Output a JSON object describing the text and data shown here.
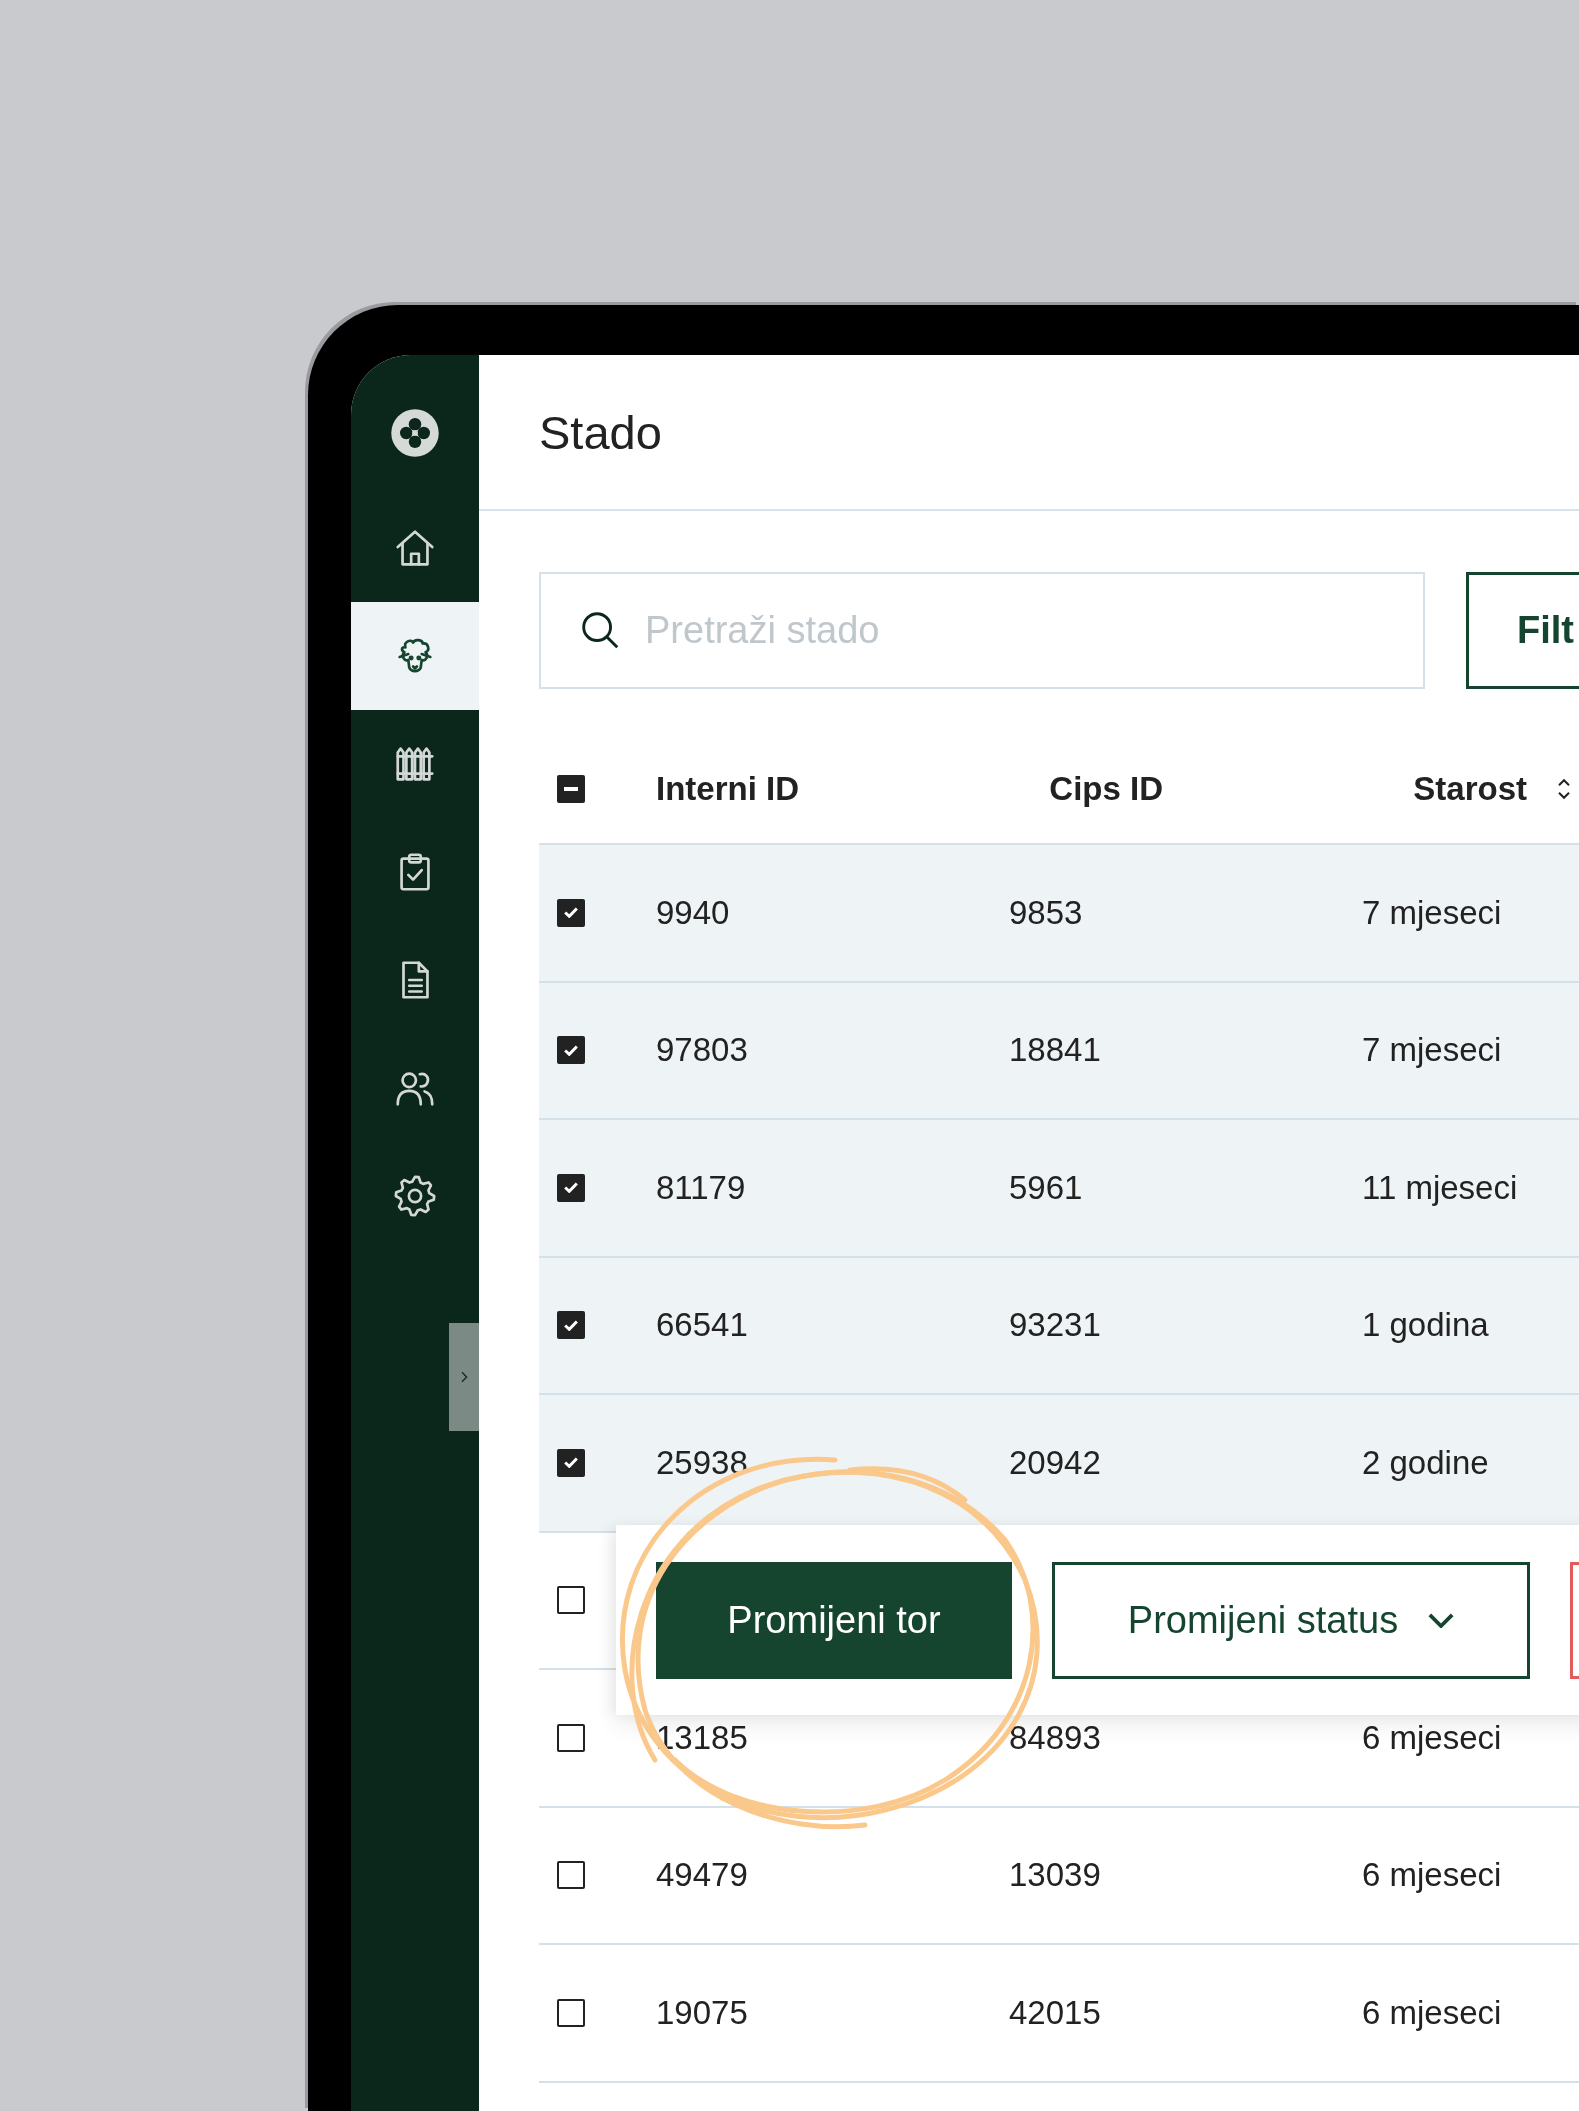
{
  "sidebar": {
    "items": [
      {
        "kind": "home",
        "selected": false
      },
      {
        "kind": "herd",
        "selected": true
      },
      {
        "kind": "fence",
        "selected": false
      },
      {
        "kind": "tasks",
        "selected": false
      },
      {
        "kind": "document",
        "selected": false
      },
      {
        "kind": "users",
        "selected": false
      },
      {
        "kind": "settings",
        "selected": false
      }
    ]
  },
  "header": {
    "title": "Stado"
  },
  "search": {
    "placeholder": "Pretraži stado"
  },
  "filter_button": {
    "label": "Filt"
  },
  "table": {
    "select_all": {
      "indeterminate": true
    },
    "columns": [
      {
        "label": "Interni ID",
        "sortable": false
      },
      {
        "label": "Cips ID",
        "sortable": false
      },
      {
        "label": "Starost",
        "sortable": true
      }
    ],
    "rows": [
      {
        "checked": true,
        "cells": [
          "9940",
          "9853",
          "7 mjeseci"
        ]
      },
      {
        "checked": true,
        "cells": [
          "97803",
          "18841",
          "7 mjeseci"
        ]
      },
      {
        "checked": true,
        "cells": [
          "81179",
          "5961",
          "11 mjeseci"
        ]
      },
      {
        "checked": true,
        "cells": [
          "66541",
          "93231",
          "1 godina"
        ]
      },
      {
        "checked": true,
        "cells": [
          "25938",
          "20942",
          "2 godine"
        ]
      },
      {
        "checked": false
      },
      {
        "checked": false,
        "cells": [
          "13185",
          "84893",
          "6 mjeseci"
        ]
      },
      {
        "checked": false,
        "cells": [
          "49479",
          "13039",
          "6 mjeseci"
        ]
      },
      {
        "checked": false,
        "cells": [
          "19075",
          "42015",
          "6 mjeseci"
        ]
      }
    ]
  },
  "action_bar": {
    "buttons": [
      {
        "kind": "primary",
        "label": "Promijeni tor"
      },
      {
        "kind": "dropdown",
        "label": "Promijeni status"
      },
      {
        "kind": "danger"
      }
    ]
  }
}
